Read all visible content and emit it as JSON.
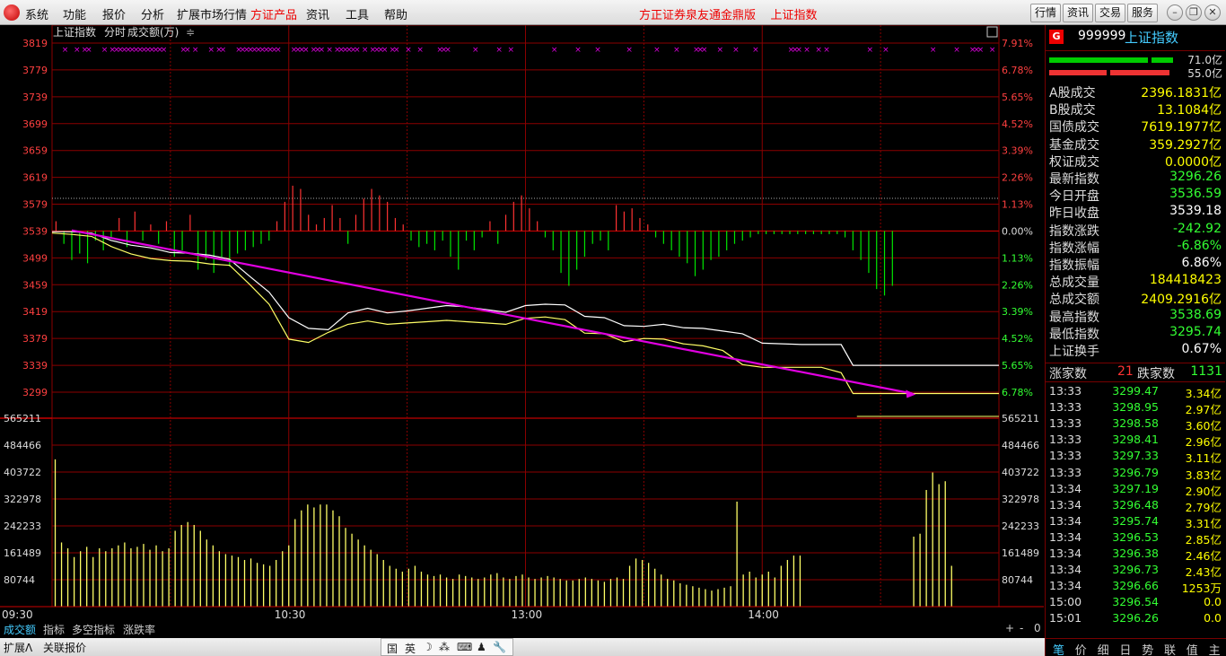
{
  "menu": [
    "系统",
    "功能",
    "报价",
    "分析",
    "扩展市场行情",
    "方证产品",
    "资讯",
    "工具",
    "帮助"
  ],
  "menu_highlight": "方证产品",
  "window_title": "方正证券泉友通金鼎版    上证指数",
  "top_buttons": [
    "行情",
    "资讯",
    "交易",
    "服务"
  ],
  "chart_header": {
    "name": "上证指数",
    "mode": "分时",
    "indicator": "成交额(万)",
    "arrows": "≑"
  },
  "colors": {
    "up": "#ff3232",
    "down": "#00e600",
    "price_line": "#ffffff",
    "avg_line": "#ffff66",
    "trend": "#e000e0",
    "grid": "#8b0000"
  },
  "chart_data": [
    {
      "type": "line",
      "title": "上证指数 分时",
      "y_left_ticks": [
        "3819",
        "3779",
        "3739",
        "3699",
        "3659",
        "3619",
        "3579",
        "3539",
        "3499",
        "3459",
        "3419",
        "3379",
        "3339",
        "3299"
      ],
      "y_right_ticks": [
        "7.91%",
        "6.78%",
        "5.65%",
        "4.52%",
        "3.39%",
        "2.26%",
        "1.13%",
        "0.00%",
        "1.13%",
        "2.26%",
        "3.39%",
        "4.52%",
        "5.65%",
        "6.78%"
      ],
      "ylim": [
        3299,
        3819
      ],
      "prev_close": 3539.18,
      "x_ticks": [
        "09:30",
        "10:30",
        "13:00",
        "14:00"
      ],
      "series": [
        {
          "name": "price",
          "points": [
            [
              0,
              3538
            ],
            [
              5,
              3538
            ],
            [
              10,
              3536
            ],
            [
              15,
              3525
            ],
            [
              20,
              3518
            ],
            [
              25,
              3514
            ],
            [
              30,
              3507
            ],
            [
              35,
              3506
            ],
            [
              40,
              3503
            ],
            [
              45,
              3497
            ],
            [
              50,
              3472
            ],
            [
              55,
              3448
            ],
            [
              60,
              3410
            ],
            [
              65,
              3394
            ],
            [
              70,
              3392
            ],
            [
              75,
              3417
            ],
            [
              80,
              3424
            ],
            [
              85,
              3417
            ],
            [
              90,
              3420
            ],
            [
              95,
              3424
            ],
            [
              100,
              3428
            ],
            [
              105,
              3426
            ],
            [
              110,
              3422
            ],
            [
              115,
              3418
            ],
            [
              120,
              3428
            ],
            [
              125,
              3430
            ],
            [
              130,
              3429
            ],
            [
              135,
              3412
            ],
            [
              140,
              3410
            ],
            [
              145,
              3398
            ],
            [
              150,
              3397
            ],
            [
              155,
              3400
            ],
            [
              160,
              3395
            ],
            [
              165,
              3394
            ],
            [
              170,
              3390
            ],
            [
              175,
              3386
            ],
            [
              180,
              3372
            ],
            [
              185,
              3371
            ],
            [
              190,
              3370
            ],
            [
              195,
              3370
            ],
            [
              200,
              3370
            ],
            [
              203,
              3339
            ],
            [
              206,
              3339
            ],
            [
              240,
              3339
            ]
          ]
        },
        {
          "name": "avg",
          "points": [
            [
              0,
              3536
            ],
            [
              5,
              3534
            ],
            [
              10,
              3531
            ],
            [
              15,
              3516
            ],
            [
              20,
              3505
            ],
            [
              25,
              3498
            ],
            [
              30,
              3495
            ],
            [
              35,
              3494
            ],
            [
              40,
              3490
            ],
            [
              45,
              3488
            ],
            [
              50,
              3460
            ],
            [
              55,
              3430
            ],
            [
              60,
              3378
            ],
            [
              65,
              3373
            ],
            [
              70,
              3388
            ],
            [
              75,
              3400
            ],
            [
              80,
              3405
            ],
            [
              85,
              3400
            ],
            [
              90,
              3402
            ],
            [
              95,
              3404
            ],
            [
              100,
              3406
            ],
            [
              105,
              3404
            ],
            [
              110,
              3402
            ],
            [
              115,
              3400
            ],
            [
              120,
              3409
            ],
            [
              125,
              3411
            ],
            [
              130,
              3407
            ],
            [
              135,
              3387
            ],
            [
              140,
              3386
            ],
            [
              145,
              3374
            ],
            [
              150,
              3379
            ],
            [
              155,
              3378
            ],
            [
              160,
              3371
            ],
            [
              165,
              3368
            ],
            [
              170,
              3361
            ],
            [
              175,
              3340
            ],
            [
              180,
              3336
            ],
            [
              185,
              3336
            ],
            [
              190,
              3336
            ],
            [
              195,
              3336
            ],
            [
              200,
              3328
            ],
            [
              203,
              3297
            ],
            [
              206,
              3297
            ],
            [
              240,
              3297
            ]
          ]
        }
      ],
      "trend_line": [
        [
          5,
          3540
        ],
        [
          218,
          3297
        ]
      ],
      "breadth_bars": [
        3,
        -4,
        -9,
        -7,
        -10,
        -3,
        -6,
        -2,
        4,
        -5,
        6,
        -3,
        2,
        -4,
        3,
        -8,
        -6,
        5,
        -12,
        -9,
        -13,
        -8,
        -11,
        -7,
        -6,
        -5,
        -4,
        -3,
        3,
        9,
        14,
        13,
        5,
        2,
        4,
        8,
        4,
        -4,
        5,
        10,
        13,
        11,
        9,
        4,
        2,
        -3,
        -5,
        -4,
        -6,
        -3,
        -8,
        -12,
        -3,
        -6,
        -2,
        3,
        -4,
        5,
        9,
        11,
        7,
        3,
        -2,
        -6,
        -13,
        -17,
        -12,
        -8,
        -4,
        -3,
        -6,
        8,
        6,
        7,
        4,
        2,
        -2,
        -4,
        -6,
        -8,
        -10,
        -14,
        -12,
        -9,
        -8,
        -6,
        -4,
        -3,
        -2,
        -1,
        -1,
        -1,
        -1,
        -1,
        -1,
        -1,
        -1,
        -1,
        -1,
        -1,
        -2,
        -6,
        -9,
        -13,
        -18,
        -20,
        -17
      ]
    },
    {
      "type": "bar",
      "title": "成交额(万)",
      "y_ticks": [
        "565211",
        "484466",
        "403722",
        "322978",
        "242233",
        "161489",
        "80744"
      ],
      "ylim": [
        0,
        645956
      ],
      "values": [
        505000,
        220000,
        200000,
        170000,
        190000,
        205000,
        170000,
        200000,
        190000,
        200000,
        210000,
        220000,
        200000,
        205000,
        215000,
        195000,
        210000,
        190000,
        200000,
        260000,
        280000,
        290000,
        280000,
        260000,
        230000,
        210000,
        190000,
        180000,
        175000,
        170000,
        160000,
        165000,
        150000,
        145000,
        140000,
        160000,
        190000,
        210000,
        300000,
        330000,
        350000,
        340000,
        350000,
        350000,
        330000,
        310000,
        270000,
        250000,
        230000,
        210000,
        195000,
        180000,
        160000,
        140000,
        130000,
        120000,
        130000,
        140000,
        120000,
        110000,
        105000,
        110000,
        100000,
        95000,
        110000,
        105000,
        100000,
        95000,
        100000,
        110000,
        115000,
        100000,
        95000,
        105000,
        110000,
        100000,
        95000,
        100000,
        105000,
        100000,
        95000,
        90000,
        90000,
        95000,
        100000,
        95000,
        90000,
        85000,
        95000,
        100000,
        95000,
        140000,
        165000,
        160000,
        150000,
        130000,
        110000,
        95000,
        90000,
        80000,
        75000,
        70000,
        65000,
        60000,
        55000,
        60000,
        65000,
        70000,
        360000,
        110000,
        120000,
        100000,
        110000,
        120000,
        100000,
        140000,
        160000,
        175000,
        175000,
        0,
        0,
        0,
        0,
        0,
        0,
        0,
        0,
        0,
        0,
        0,
        0,
        0,
        0,
        0,
        0,
        0,
        240000,
        250000,
        400000,
        460000,
        420000,
        430000,
        140000
      ]
    }
  ],
  "right_panel": {
    "badge": "G",
    "code": "999999",
    "name": "上证指数",
    "bar_up_label": "71.0亿",
    "bar_down_label": "55.0亿",
    "rows": [
      {
        "label": "A股成交",
        "value": "2396.1831亿",
        "color": "#ffff00"
      },
      {
        "label": "B股成交",
        "value": "13.1084亿",
        "color": "#ffff00"
      },
      {
        "label": "国债成交",
        "value": "7619.1977亿",
        "color": "#ffff00"
      },
      {
        "label": "基金成交",
        "value": "359.2927亿",
        "color": "#ffff00"
      },
      {
        "label": "权证成交",
        "value": "0.0000亿",
        "color": "#ffff00"
      },
      {
        "label": "最新指数",
        "value": "3296.26",
        "color": "#33ff33"
      },
      {
        "label": "今日开盘",
        "value": "3536.59",
        "color": "#33ff33"
      },
      {
        "label": "昨日收盘",
        "value": "3539.18",
        "color": "#ffffff"
      },
      {
        "label": "指数涨跌",
        "value": "-242.92",
        "color": "#33ff33"
      },
      {
        "label": "指数涨幅",
        "value": "-6.86%",
        "color": "#33ff33"
      },
      {
        "label": "指数振幅",
        "value": "6.86%",
        "color": "#ffffff"
      },
      {
        "label": "总成交量",
        "value": "184418423",
        "color": "#ffff00"
      },
      {
        "label": "总成交额",
        "value": "2409.2916亿",
        "color": "#ffff00"
      },
      {
        "label": "最高指数",
        "value": "3538.69",
        "color": "#33ff33"
      },
      {
        "label": "最低指数",
        "value": "3295.74",
        "color": "#33ff33"
      },
      {
        "label": "上证换手",
        "value": "0.67%",
        "color": "#ffffff"
      }
    ],
    "up_count_label": "涨家数",
    "up_count": "21",
    "down_count_label": "跌家数",
    "down_count": "1131",
    "ticks": [
      {
        "time": "13:33",
        "price": "3299.47",
        "vol": "3.34亿"
      },
      {
        "time": "13:33",
        "price": "3298.95",
        "vol": "2.97亿"
      },
      {
        "time": "13:33",
        "price": "3298.58",
        "vol": "3.60亿"
      },
      {
        "time": "13:33",
        "price": "3298.41",
        "vol": "2.96亿"
      },
      {
        "time": "13:33",
        "price": "3297.33",
        "vol": "3.11亿"
      },
      {
        "time": "13:33",
        "price": "3296.79",
        "vol": "3.83亿"
      },
      {
        "time": "13:34",
        "price": "3297.19",
        "vol": "2.90亿"
      },
      {
        "time": "13:34",
        "price": "3296.48",
        "vol": "2.79亿"
      },
      {
        "time": "13:34",
        "price": "3295.74",
        "vol": "3.31亿"
      },
      {
        "time": "13:34",
        "price": "3296.53",
        "vol": "2.85亿"
      },
      {
        "time": "13:34",
        "price": "3296.38",
        "vol": "2.46亿"
      },
      {
        "time": "13:34",
        "price": "3296.73",
        "vol": "2.43亿"
      },
      {
        "time": "13:34",
        "price": "3296.66",
        "vol": "1253万"
      },
      {
        "time": "15:00",
        "price": "3296.54",
        "vol": "0.0"
      },
      {
        "time": "15:01",
        "price": "3296.26",
        "vol": "0.0"
      }
    ],
    "tabs": [
      "笔",
      "价",
      "细",
      "日",
      "势",
      "联",
      "值",
      "主"
    ]
  },
  "bottom_tabs": [
    "成交额",
    "指标",
    "多空指标",
    "涨跌率"
  ],
  "bottom_tab_controls": [
    "+",
    "-",
    "0"
  ],
  "status_items": [
    "扩展Λ",
    "关联报价"
  ],
  "ime": [
    "国",
    "英",
    "☽",
    "⁂",
    "⌨",
    "♟",
    "🔧"
  ]
}
